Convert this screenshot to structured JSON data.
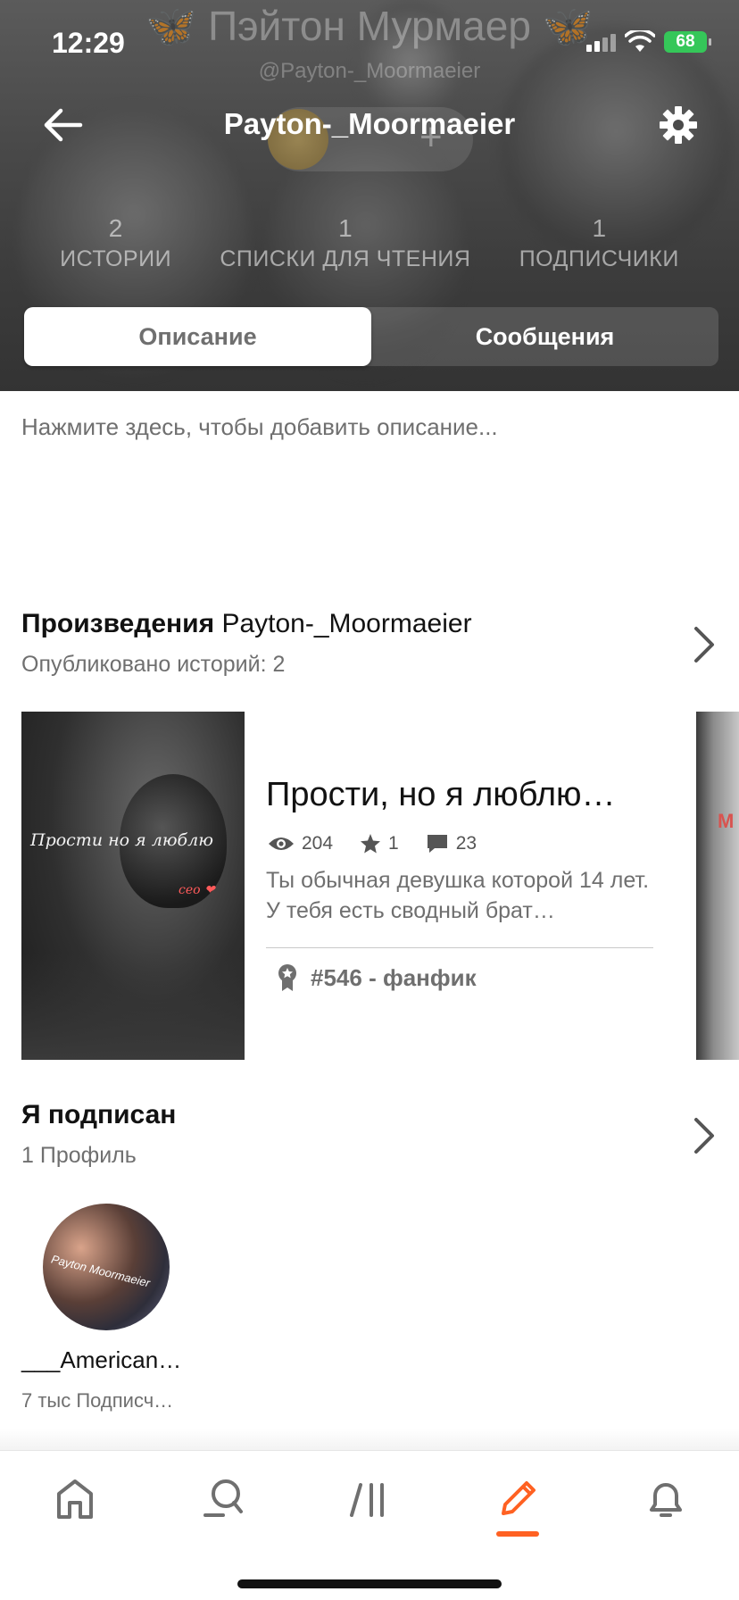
{
  "status_bar": {
    "time": "12:29",
    "battery": "68"
  },
  "header": {
    "background_name": "Пэйтон Мурмаер",
    "background_name_decoration": "🦋",
    "background_handle": "@Payton-_Moormaeier",
    "title": "Payton-_Moormaeier",
    "stats": [
      {
        "value": "2",
        "label": "ИСТОРИИ"
      },
      {
        "value": "1",
        "label": "СПИСКИ ДЛЯ ЧТЕНИЯ"
      },
      {
        "value": "1",
        "label": "ПОДПИСЧИКИ"
      }
    ],
    "tabs": [
      {
        "label": "Описание",
        "active": true
      },
      {
        "label": "Сообщения",
        "active": false
      }
    ]
  },
  "description": {
    "placeholder": "Нажмите здесь, чтобы добавить описание..."
  },
  "works": {
    "title": "Произведения",
    "author": "Payton-_Moormaeier",
    "subtitle": "Опубликовано историй: 2",
    "stories": [
      {
        "cover_text": "Прости но я люблю",
        "cover_subtext": "ceo",
        "title": "Прости, но я люблю…",
        "views": "204",
        "votes": "1",
        "comments": "23",
        "description": "Ты обычная девушка которой 14 лет. У тебя есть сводный брат…",
        "rank": "#546 - фанфик"
      }
    ],
    "next_cover_text": "M"
  },
  "following": {
    "title": "Я подписан",
    "subtitle": "1 Профиль",
    "profiles": [
      {
        "avatar_text": "Payton Moormaeier",
        "name": "___American…",
        "followers": "7 тыс Подписч…"
      }
    ]
  },
  "bottom_nav": {
    "items": [
      "home-icon",
      "search-icon",
      "library-icon",
      "write-icon",
      "notifications-icon"
    ],
    "active": "write-icon"
  },
  "colors": {
    "accent": "#ff6122",
    "text_primary": "#121212",
    "text_secondary": "#6f6f6f"
  }
}
